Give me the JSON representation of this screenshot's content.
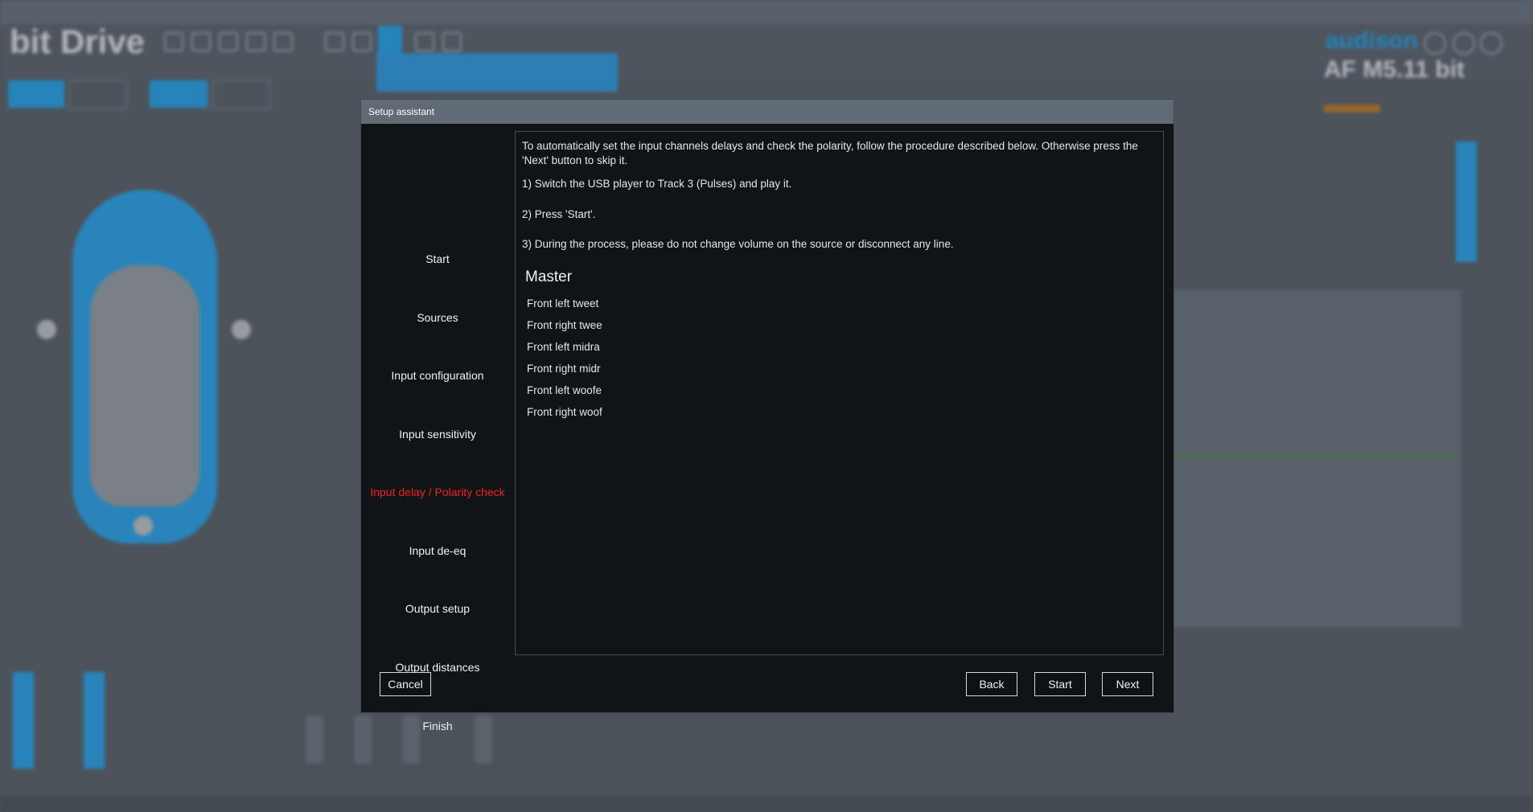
{
  "background_app": {
    "logo": "bit Drive",
    "brand": "audison",
    "model": "AF M5.11 bit"
  },
  "dialog": {
    "title": "Setup assistant",
    "nav": [
      {
        "label": "Start",
        "active": false
      },
      {
        "label": "Sources",
        "active": false
      },
      {
        "label": "Input configuration",
        "active": false
      },
      {
        "label": "Input sensitivity",
        "active": false
      },
      {
        "label": "Input delay / Polarity check",
        "active": true
      },
      {
        "label": "Input de-eq",
        "active": false
      },
      {
        "label": "Output setup",
        "active": false
      },
      {
        "label": "Output distances",
        "active": false
      },
      {
        "label": "Finish",
        "active": false
      }
    ],
    "active_color": "#f0251f",
    "content": {
      "intro": "To automatically set the input channels delays and check the polarity, follow the procedure described below. Otherwise press the 'Next' button to skip it.",
      "step1": "1) Switch the USB player to Track 3 (Pulses) and play it.",
      "step2": "2) Press 'Start'.",
      "step3": "3) During the process, please do not change volume on the source or disconnect any line.",
      "group_title": "Master",
      "channels": [
        "Front left tweet",
        "Front right twee",
        "Front left midra",
        "Front right midr",
        "Front left woofe",
        "Front right woof"
      ]
    },
    "buttons": {
      "cancel": "Cancel",
      "back": "Back",
      "start": "Start",
      "next": "Next"
    }
  }
}
